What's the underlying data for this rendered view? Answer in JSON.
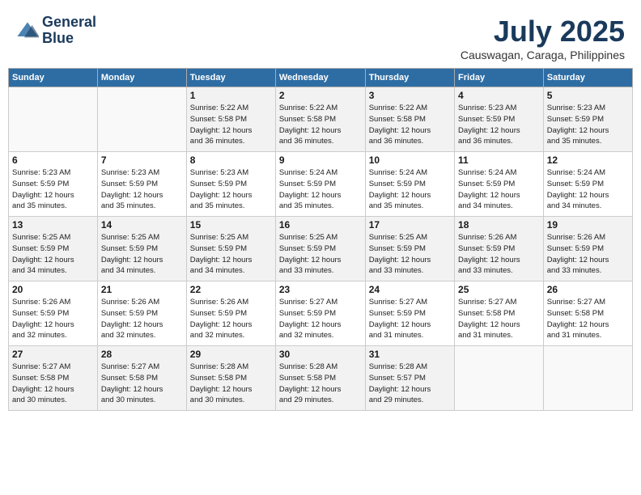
{
  "header": {
    "logo_line1": "General",
    "logo_line2": "Blue",
    "month": "July 2025",
    "location": "Causwagan, Caraga, Philippines"
  },
  "days_of_week": [
    "Sunday",
    "Monday",
    "Tuesday",
    "Wednesday",
    "Thursday",
    "Friday",
    "Saturday"
  ],
  "weeks": [
    [
      {
        "day": "",
        "info": ""
      },
      {
        "day": "",
        "info": ""
      },
      {
        "day": "1",
        "info": "Sunrise: 5:22 AM\nSunset: 5:58 PM\nDaylight: 12 hours\nand 36 minutes."
      },
      {
        "day": "2",
        "info": "Sunrise: 5:22 AM\nSunset: 5:58 PM\nDaylight: 12 hours\nand 36 minutes."
      },
      {
        "day": "3",
        "info": "Sunrise: 5:22 AM\nSunset: 5:58 PM\nDaylight: 12 hours\nand 36 minutes."
      },
      {
        "day": "4",
        "info": "Sunrise: 5:23 AM\nSunset: 5:59 PM\nDaylight: 12 hours\nand 36 minutes."
      },
      {
        "day": "5",
        "info": "Sunrise: 5:23 AM\nSunset: 5:59 PM\nDaylight: 12 hours\nand 35 minutes."
      }
    ],
    [
      {
        "day": "6",
        "info": "Sunrise: 5:23 AM\nSunset: 5:59 PM\nDaylight: 12 hours\nand 35 minutes."
      },
      {
        "day": "7",
        "info": "Sunrise: 5:23 AM\nSunset: 5:59 PM\nDaylight: 12 hours\nand 35 minutes."
      },
      {
        "day": "8",
        "info": "Sunrise: 5:23 AM\nSunset: 5:59 PM\nDaylight: 12 hours\nand 35 minutes."
      },
      {
        "day": "9",
        "info": "Sunrise: 5:24 AM\nSunset: 5:59 PM\nDaylight: 12 hours\nand 35 minutes."
      },
      {
        "day": "10",
        "info": "Sunrise: 5:24 AM\nSunset: 5:59 PM\nDaylight: 12 hours\nand 35 minutes."
      },
      {
        "day": "11",
        "info": "Sunrise: 5:24 AM\nSunset: 5:59 PM\nDaylight: 12 hours\nand 34 minutes."
      },
      {
        "day": "12",
        "info": "Sunrise: 5:24 AM\nSunset: 5:59 PM\nDaylight: 12 hours\nand 34 minutes."
      }
    ],
    [
      {
        "day": "13",
        "info": "Sunrise: 5:25 AM\nSunset: 5:59 PM\nDaylight: 12 hours\nand 34 minutes."
      },
      {
        "day": "14",
        "info": "Sunrise: 5:25 AM\nSunset: 5:59 PM\nDaylight: 12 hours\nand 34 minutes."
      },
      {
        "day": "15",
        "info": "Sunrise: 5:25 AM\nSunset: 5:59 PM\nDaylight: 12 hours\nand 34 minutes."
      },
      {
        "day": "16",
        "info": "Sunrise: 5:25 AM\nSunset: 5:59 PM\nDaylight: 12 hours\nand 33 minutes."
      },
      {
        "day": "17",
        "info": "Sunrise: 5:25 AM\nSunset: 5:59 PM\nDaylight: 12 hours\nand 33 minutes."
      },
      {
        "day": "18",
        "info": "Sunrise: 5:26 AM\nSunset: 5:59 PM\nDaylight: 12 hours\nand 33 minutes."
      },
      {
        "day": "19",
        "info": "Sunrise: 5:26 AM\nSunset: 5:59 PM\nDaylight: 12 hours\nand 33 minutes."
      }
    ],
    [
      {
        "day": "20",
        "info": "Sunrise: 5:26 AM\nSunset: 5:59 PM\nDaylight: 12 hours\nand 32 minutes."
      },
      {
        "day": "21",
        "info": "Sunrise: 5:26 AM\nSunset: 5:59 PM\nDaylight: 12 hours\nand 32 minutes."
      },
      {
        "day": "22",
        "info": "Sunrise: 5:26 AM\nSunset: 5:59 PM\nDaylight: 12 hours\nand 32 minutes."
      },
      {
        "day": "23",
        "info": "Sunrise: 5:27 AM\nSunset: 5:59 PM\nDaylight: 12 hours\nand 32 minutes."
      },
      {
        "day": "24",
        "info": "Sunrise: 5:27 AM\nSunset: 5:59 PM\nDaylight: 12 hours\nand 31 minutes."
      },
      {
        "day": "25",
        "info": "Sunrise: 5:27 AM\nSunset: 5:58 PM\nDaylight: 12 hours\nand 31 minutes."
      },
      {
        "day": "26",
        "info": "Sunrise: 5:27 AM\nSunset: 5:58 PM\nDaylight: 12 hours\nand 31 minutes."
      }
    ],
    [
      {
        "day": "27",
        "info": "Sunrise: 5:27 AM\nSunset: 5:58 PM\nDaylight: 12 hours\nand 30 minutes."
      },
      {
        "day": "28",
        "info": "Sunrise: 5:27 AM\nSunset: 5:58 PM\nDaylight: 12 hours\nand 30 minutes."
      },
      {
        "day": "29",
        "info": "Sunrise: 5:28 AM\nSunset: 5:58 PM\nDaylight: 12 hours\nand 30 minutes."
      },
      {
        "day": "30",
        "info": "Sunrise: 5:28 AM\nSunset: 5:58 PM\nDaylight: 12 hours\nand 29 minutes."
      },
      {
        "day": "31",
        "info": "Sunrise: 5:28 AM\nSunset: 5:57 PM\nDaylight: 12 hours\nand 29 minutes."
      },
      {
        "day": "",
        "info": ""
      },
      {
        "day": "",
        "info": ""
      }
    ]
  ]
}
